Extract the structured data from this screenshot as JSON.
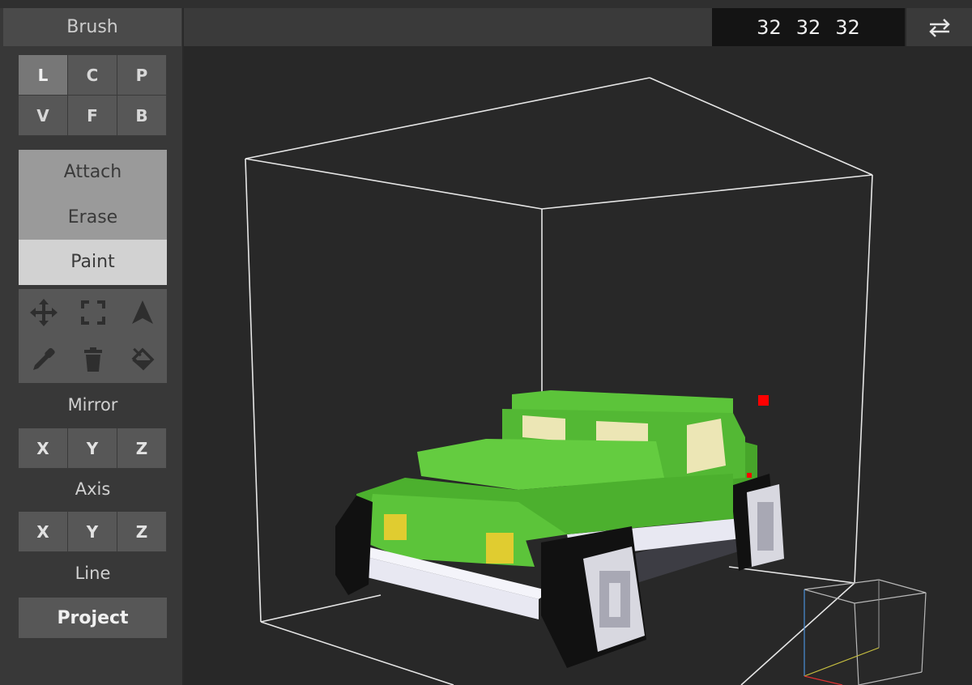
{
  "sidebar": {
    "title": "Brush",
    "modes": [
      "L",
      "C",
      "P",
      "V",
      "F",
      "B"
    ],
    "active_mode": "L",
    "operations": [
      "Attach",
      "Erase",
      "Paint"
    ],
    "selected_operation": "Paint",
    "tools": [
      {
        "icon": "move-icon"
      },
      {
        "icon": "select-box-icon"
      },
      {
        "icon": "navigate-arrow-icon"
      },
      {
        "icon": "eyedropper-icon"
      },
      {
        "icon": "trash-icon"
      },
      {
        "icon": "paint-bucket-icon"
      }
    ],
    "mirror": {
      "label": "Mirror",
      "buttons": [
        "X",
        "Y",
        "Z"
      ]
    },
    "axis": {
      "label": "Axis",
      "buttons": [
        "X",
        "Y",
        "Z"
      ]
    },
    "line": {
      "label": "Line",
      "button": "Project"
    }
  },
  "toolbar": {
    "dims": [
      "32",
      "32",
      "32"
    ],
    "swap_icon": "swap-arrows-icon"
  },
  "viewport": {
    "model": "green voxel car",
    "colors": {
      "body": "#5cc43a",
      "body_shade": "#47a52a",
      "window": "#ece6b5",
      "headlight": "#e0cc30",
      "wheel": "#111111",
      "hub": "#d8d8e0",
      "bumper": "#e8e8f2",
      "cursor": "#ff0000"
    },
    "gizmo": "orientation-cube-icon"
  }
}
